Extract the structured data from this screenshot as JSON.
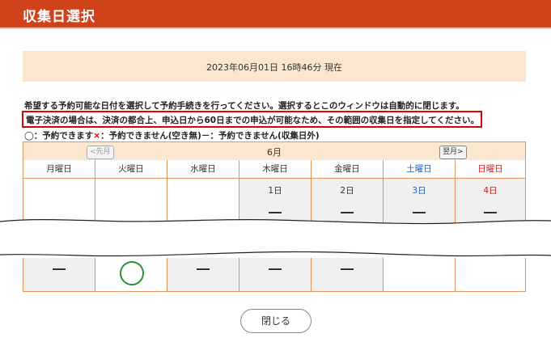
{
  "header": {
    "title": "収集日選択"
  },
  "datetime": "2023年06月01日 16時46分 現在",
  "instruction": "希望する予約可能な日付を選択して予約手続きを行ってください。選択するとこのウィンドウは自動的に閉じます。",
  "notice": "電子決済の場合は、決済の都合上、申込日から60日までの申込が可能なため、その範囲の収集日を指定してください。",
  "legend": {
    "available": "◯：予約できます",
    "unavailable_mark": "×",
    "unavailable": "：予約できません(空き無)",
    "outside": "－：予約できません(収集日外)"
  },
  "calendar": {
    "month": "6月",
    "prev": "<先月",
    "next": "翌月>",
    "weekdays": [
      "月曜日",
      "火曜日",
      "水曜日",
      "木曜日",
      "金曜日",
      "土曜日",
      "日曜日"
    ],
    "row1_dates": [
      "",
      "",
      "",
      "1日",
      "2日",
      "3日",
      "4日"
    ]
  },
  "colors": {
    "header": "#d0431a",
    "accent_bg": "#fbe6cf",
    "border": "#e0945e",
    "notice_border": "#e00000",
    "circle": "#2f8f3a",
    "saturday": "#1a5fc2",
    "sunday": "#d31a1a"
  },
  "close_label": "閉じる"
}
